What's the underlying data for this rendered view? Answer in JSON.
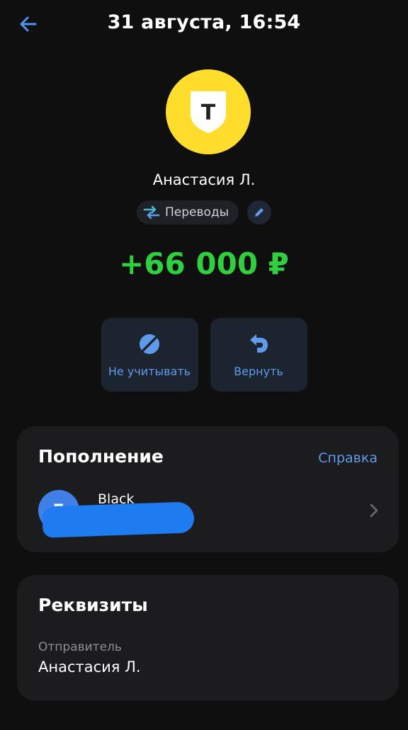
{
  "header": {
    "title": "31 августа, 16:54",
    "back_icon": "arrow-left-icon"
  },
  "operation": {
    "logo_letter": "Т",
    "logo_color": "#ffdd2d",
    "counterparty": "Анастасия Л.",
    "category": "Переводы",
    "category_icon": "transfer-arrows-icon",
    "edit_icon": "pencil-icon",
    "amount": "+66 000 ₽",
    "amount_color": "#2fcf3f"
  },
  "actions": [
    {
      "label": "Не учитывать",
      "icon": "not-count-icon"
    },
    {
      "label": "Вернуть",
      "icon": "return-arrow-icon"
    }
  ],
  "topup": {
    "title": "Пополнение",
    "help_label": "Справка",
    "account_name": "Black",
    "account_icon": "card-avatar-icon"
  },
  "details": {
    "title": "Реквизиты",
    "sender_label": "Отправитель",
    "sender_value": "Анастасия Л."
  },
  "colors": {
    "accent": "#5f9bea",
    "background": "#0f0f10",
    "card": "#1c1c1e"
  }
}
